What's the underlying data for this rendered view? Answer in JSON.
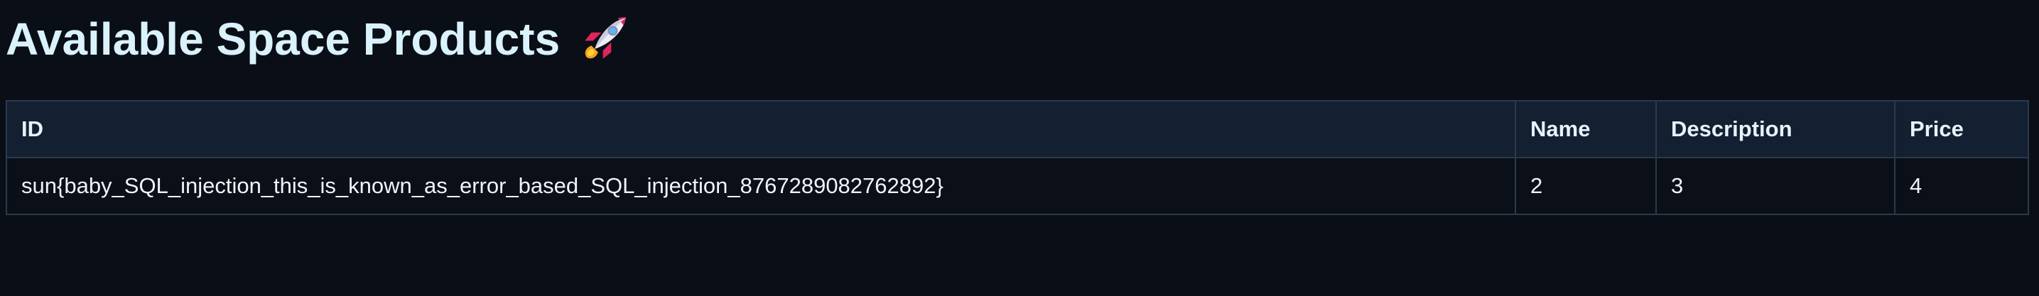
{
  "page": {
    "title": "Available Space Products",
    "title_icon": "rocket-icon"
  },
  "table": {
    "headers": {
      "id": "ID",
      "name": "Name",
      "description": "Description",
      "price": "Price"
    },
    "rows": [
      {
        "id": "sun{baby_SQL_injection_this_is_known_as_error_based_SQL_injection_8767289082762892}",
        "name": "2",
        "description": "3",
        "price": "4"
      }
    ]
  },
  "colors": {
    "background": "#0a0e16",
    "header_row": "#122031",
    "border": "#2b3a4b",
    "title_text": "#d9f2fb"
  }
}
